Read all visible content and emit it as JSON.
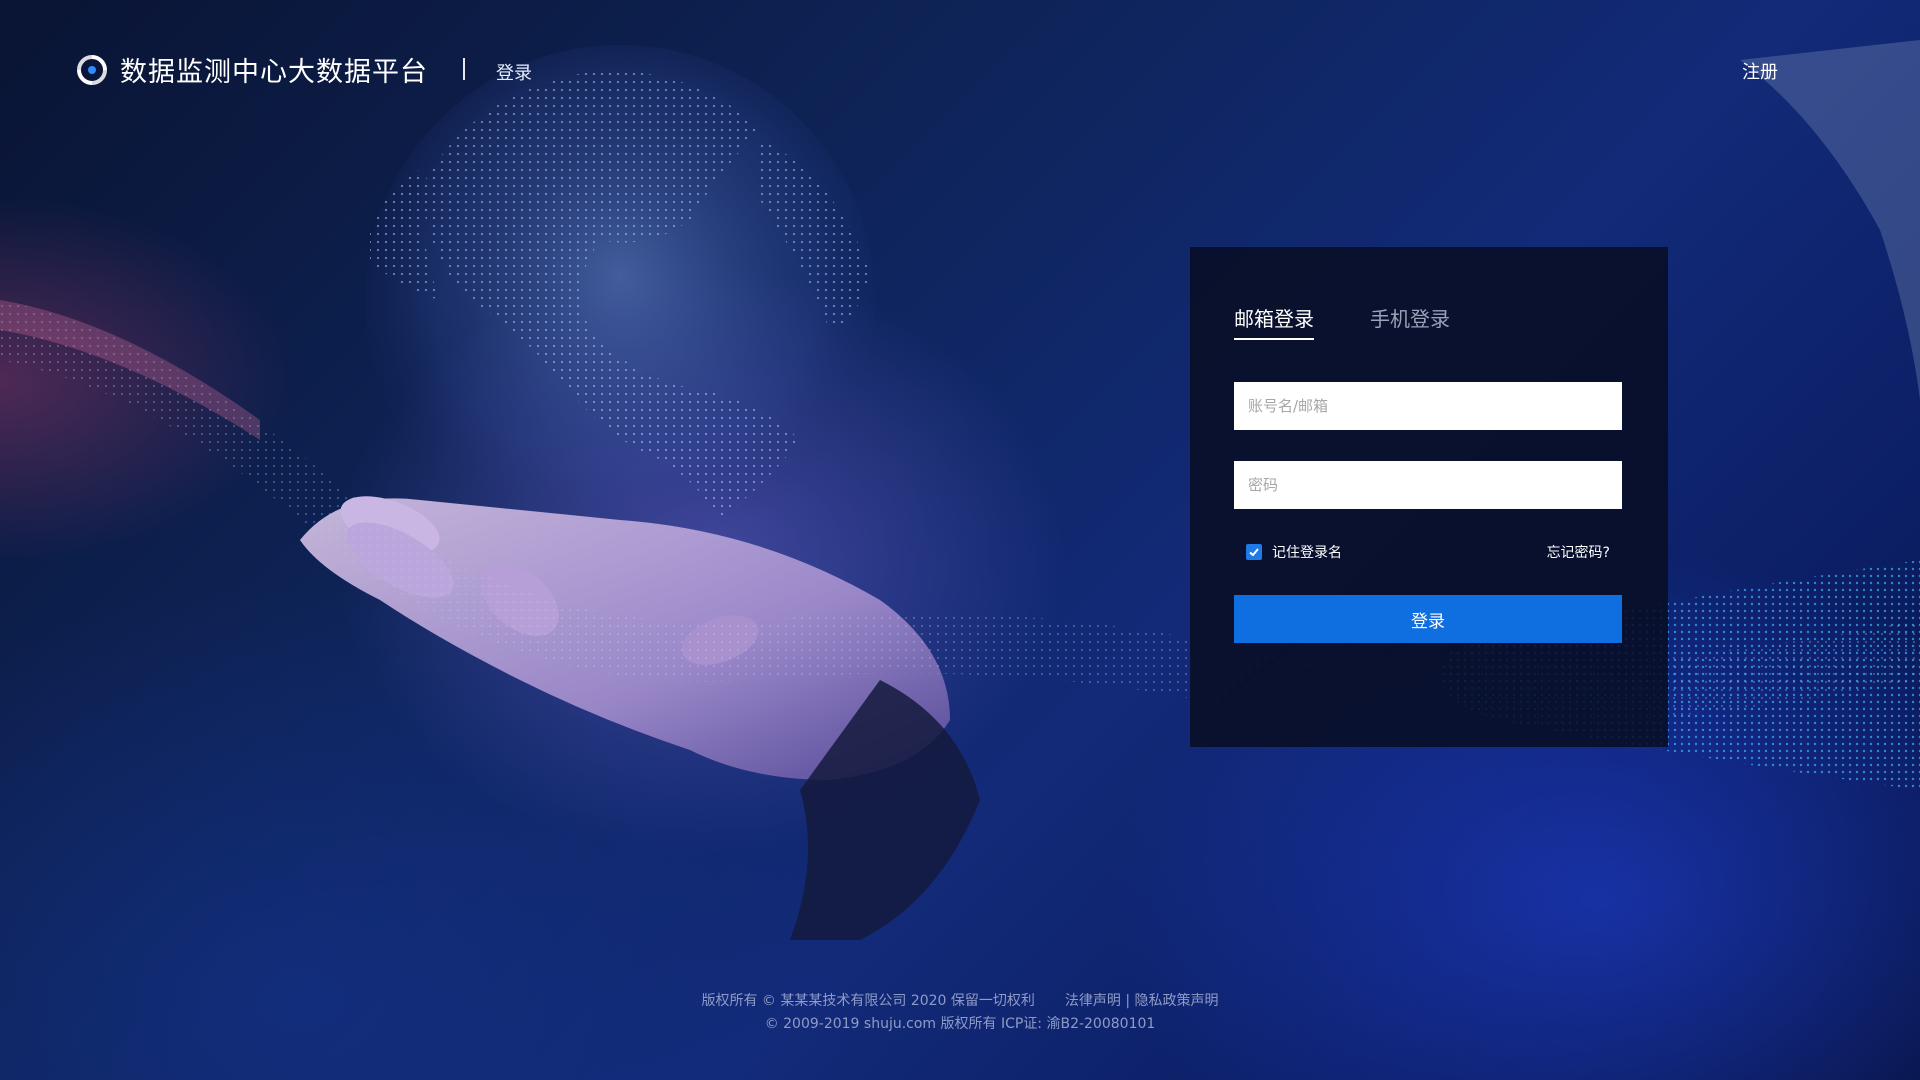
{
  "header": {
    "app_title": "数据监测中心大数据平台",
    "separator": "|",
    "login_link": "登录",
    "register_link": "注册"
  },
  "login_panel": {
    "tabs": [
      {
        "label": "邮箱登录",
        "active": true
      },
      {
        "label": "手机登录",
        "active": false
      }
    ],
    "username_placeholder": "账号名/邮箱",
    "password_placeholder": "密码",
    "remember_label": "记住登录名",
    "remember_checked": true,
    "forgot_link": "忘记密码?",
    "submit_label": "登录"
  },
  "footer": {
    "line1_copyright": "版权所有 © 某某某技术有限公司 2020 保留一切权利",
    "line1_legal": "法律声明",
    "line1_divider": "|",
    "line1_privacy": "隐私政策声明",
    "line2": "© 2009-2019 shuju.com 版权所有 ICP证: 渝B2-20080101"
  },
  "colors": {
    "primary_button": "#0f6fe0",
    "checkbox": "#1f7ae8",
    "panel_bg": "#080e24",
    "footer_text": "#8f9bc7"
  },
  "icons": {
    "logo": "logo-icon",
    "checkbox": "check-icon"
  }
}
